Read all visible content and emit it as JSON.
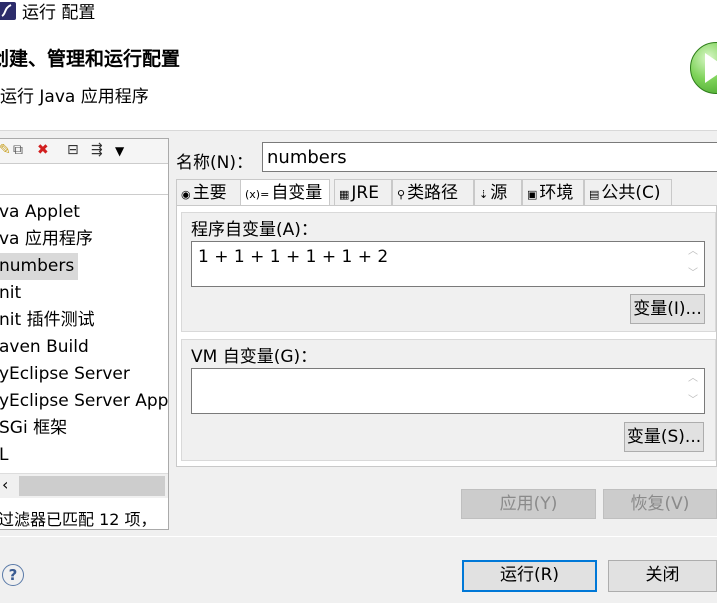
{
  "window": {
    "title": "运行 配置"
  },
  "header": {
    "title": "创建、管理和运行配置",
    "subtitle": "运行 Java 应用程序",
    "icon": "run-icon"
  },
  "left_panel": {
    "toolbar": {
      "new_icon": "new-config-icon",
      "duplicate_icon": "duplicate-icon",
      "delete_icon": "delete-icon",
      "collapse_icon": "collapse-all-icon",
      "filter_icon": "filter-icon",
      "menu_icon": "dropdown-menu-icon"
    },
    "filter_placeholder": "",
    "tree": [
      {
        "label": "Java Applet",
        "shown": "va Applet"
      },
      {
        "label": "Java 应用程序",
        "shown": "va 应用程序"
      },
      {
        "label": "numbers",
        "shown": "numbers",
        "selected": true
      },
      {
        "label": "JUnit",
        "shown": "nit"
      },
      {
        "label": "JUnit 插件测试",
        "shown": "nit 插件测试"
      },
      {
        "label": "Maven Build",
        "shown": "aven Build"
      },
      {
        "label": "MyEclipse Server",
        "shown": "yEclipse Server"
      },
      {
        "label": "MyEclipse Server Appl",
        "shown": "yEclipse Server Appl"
      },
      {
        "label": "OSGi 框架",
        "shown": "SGi 框架"
      },
      {
        "label": "XSL",
        "shown": "L"
      }
    ],
    "filter_status": "过滤器已匹配 12 项，"
  },
  "config": {
    "name_label": "名称(N)：",
    "name_value": "numbers",
    "tabs": [
      {
        "label": "主要",
        "icon": "main-tab-icon"
      },
      {
        "label": "自变量",
        "icon": "arguments-tab-icon",
        "active": true
      },
      {
        "label": "JRE",
        "icon": "jre-tab-icon"
      },
      {
        "label": "类路径",
        "icon": "classpath-tab-icon"
      },
      {
        "label": "源",
        "icon": "source-tab-icon"
      },
      {
        "label": "环境",
        "icon": "environment-tab-icon"
      },
      {
        "label": "公共(C)",
        "icon": "common-tab-icon"
      }
    ],
    "program_args_label": "程序自变量(A)：",
    "program_args_value": "1 + 1 + 1 + 1 + 1 + 2",
    "program_vars_button": "变量(I)...",
    "vm_args_label": "VM 自变量(G)：",
    "vm_args_value": "",
    "vm_vars_button": "变量(S)..."
  },
  "buttons": {
    "apply": "应用(Y)",
    "revert": "恢复(V)",
    "run": "运行(R)",
    "close": "关闭"
  }
}
